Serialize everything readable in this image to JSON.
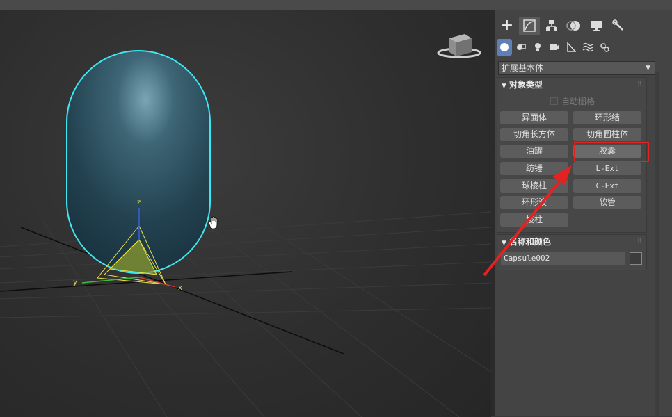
{
  "panel": {
    "tabs": [
      "create-tab",
      "modify-tab",
      "hierarchy-tab",
      "motion-tab",
      "display-tab",
      "utilities-tab"
    ],
    "subtabs": [
      "geometry-icon",
      "shapes-icon",
      "lights-icon",
      "cameras-icon",
      "helpers-icon",
      "spacewarps-icon",
      "systems-icon"
    ],
    "dropdown": {
      "value": "扩展基本体"
    },
    "object_type": {
      "title": "对象类型",
      "auto_grid": "自动栅格",
      "buttons": [
        "异面体",
        "环形结",
        "切角长方体",
        "切角圆柱体",
        "油罐",
        "胶囊",
        "纺锤",
        "L-Ext",
        "球棱柱",
        "C-Ext",
        "环形波",
        "软管",
        "棱柱"
      ]
    },
    "name_color": {
      "title": "名称和颜色",
      "name_value": "Capsule002"
    }
  },
  "viewport": {
    "axis_labels": {
      "x": "x",
      "y": "y",
      "z": "z"
    }
  },
  "colors": {
    "highlight": "#e52222",
    "selection": "#3fe6f0",
    "gizmo": "#e8e04a"
  }
}
